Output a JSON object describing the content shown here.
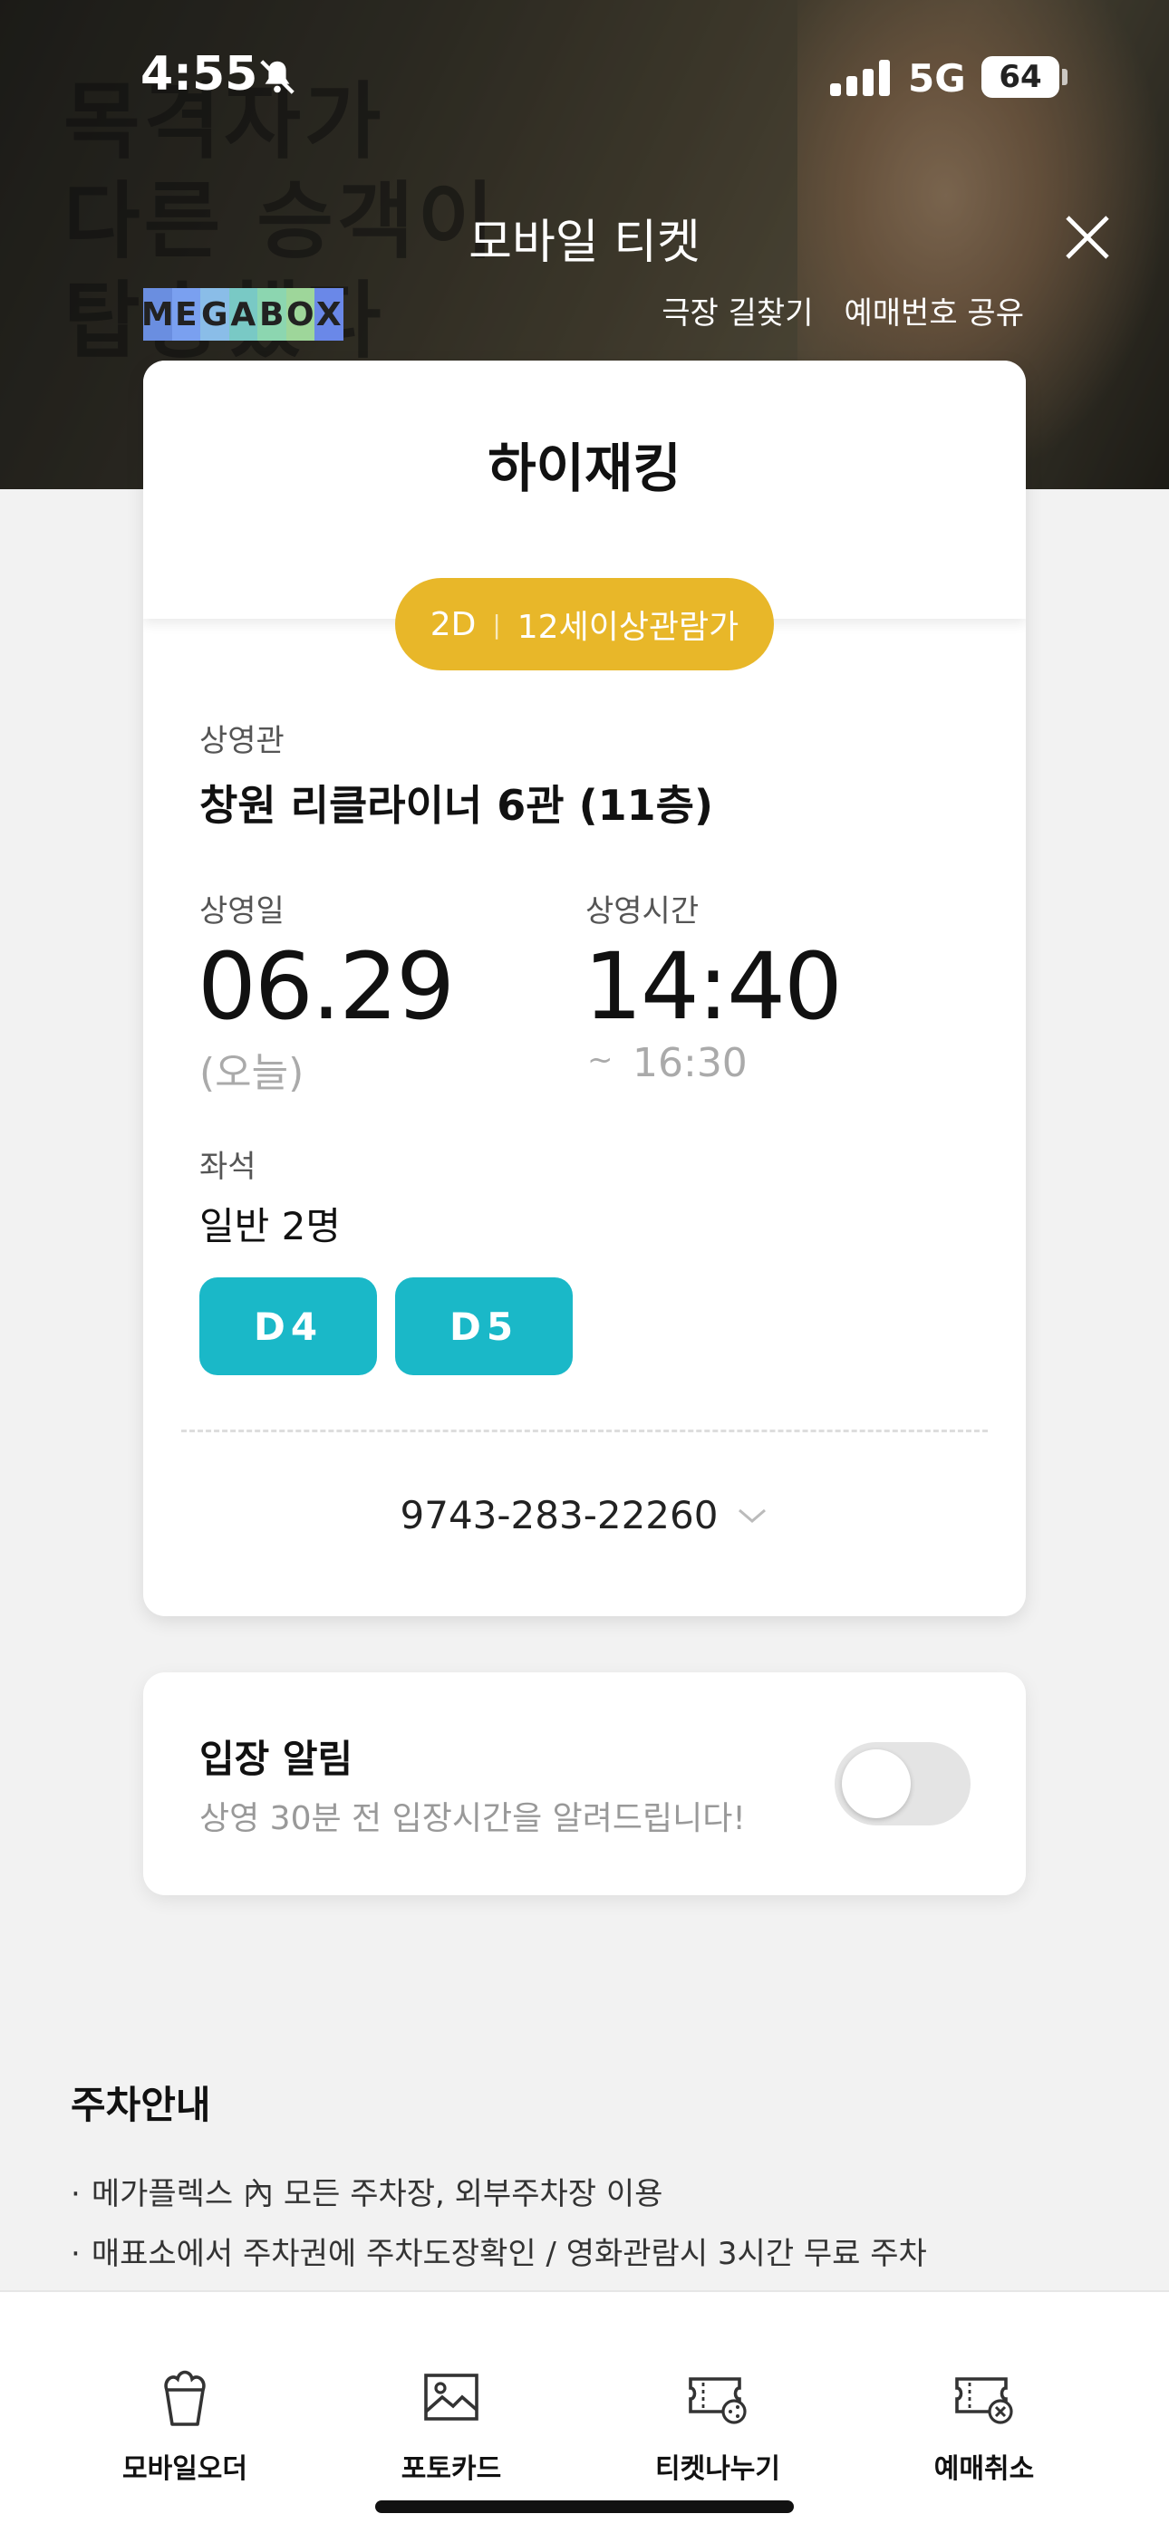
{
  "status": {
    "time": "4:55",
    "network": "5G",
    "battery": "64"
  },
  "header": {
    "title": "모바일 티켓",
    "brand_letters": [
      "M",
      "E",
      "G",
      "A",
      "B",
      "O",
      "X"
    ],
    "brand_colors": [
      "#6a8ee0",
      "#7aa0f0",
      "#8abde8",
      "#79c9c5",
      "#8cd6b0",
      "#9ed69a",
      "#6a88e8"
    ],
    "links": {
      "directions": "극장 길찾기",
      "share": "예매번호 공유"
    },
    "poster_text": [
      "목격자가",
      "다른 승객이",
      "탑승했다"
    ]
  },
  "ticket": {
    "movie_title": "하이재킹",
    "format": "2D",
    "rating": "12세이상관람가",
    "theater_label": "상영관",
    "theater": "창원 리클라이너 6관 (11층)",
    "date_label": "상영일",
    "date": "06.29",
    "date_note": "(오늘)",
    "time_label": "상영시간",
    "start_time": "14:40",
    "end_prefix": "~",
    "end_time": "16:30",
    "seat_label": "좌석",
    "seat_count": "일반 2명",
    "seats": [
      "D4",
      "D5"
    ],
    "booking_number": "9743-283-22260"
  },
  "entry_alert": {
    "title": "입장 알림",
    "description": "상영 30분 전 입장시간을 알려드립니다!",
    "enabled": false
  },
  "parking": {
    "title": "주차안내",
    "items": [
      "메가플렉스 內 모든 주차장, 외부주차장 이용",
      "매표소에서 주차권에 주차도장확인 / 영화관람시 3시간 무료 주차"
    ]
  },
  "bottom_nav": [
    {
      "label": "모바일오더",
      "icon": "popcorn-icon"
    },
    {
      "label": "포토카드",
      "icon": "photo-icon"
    },
    {
      "label": "티켓나누기",
      "icon": "ticket-share-icon"
    },
    {
      "label": "예매취소",
      "icon": "ticket-cancel-icon"
    }
  ]
}
